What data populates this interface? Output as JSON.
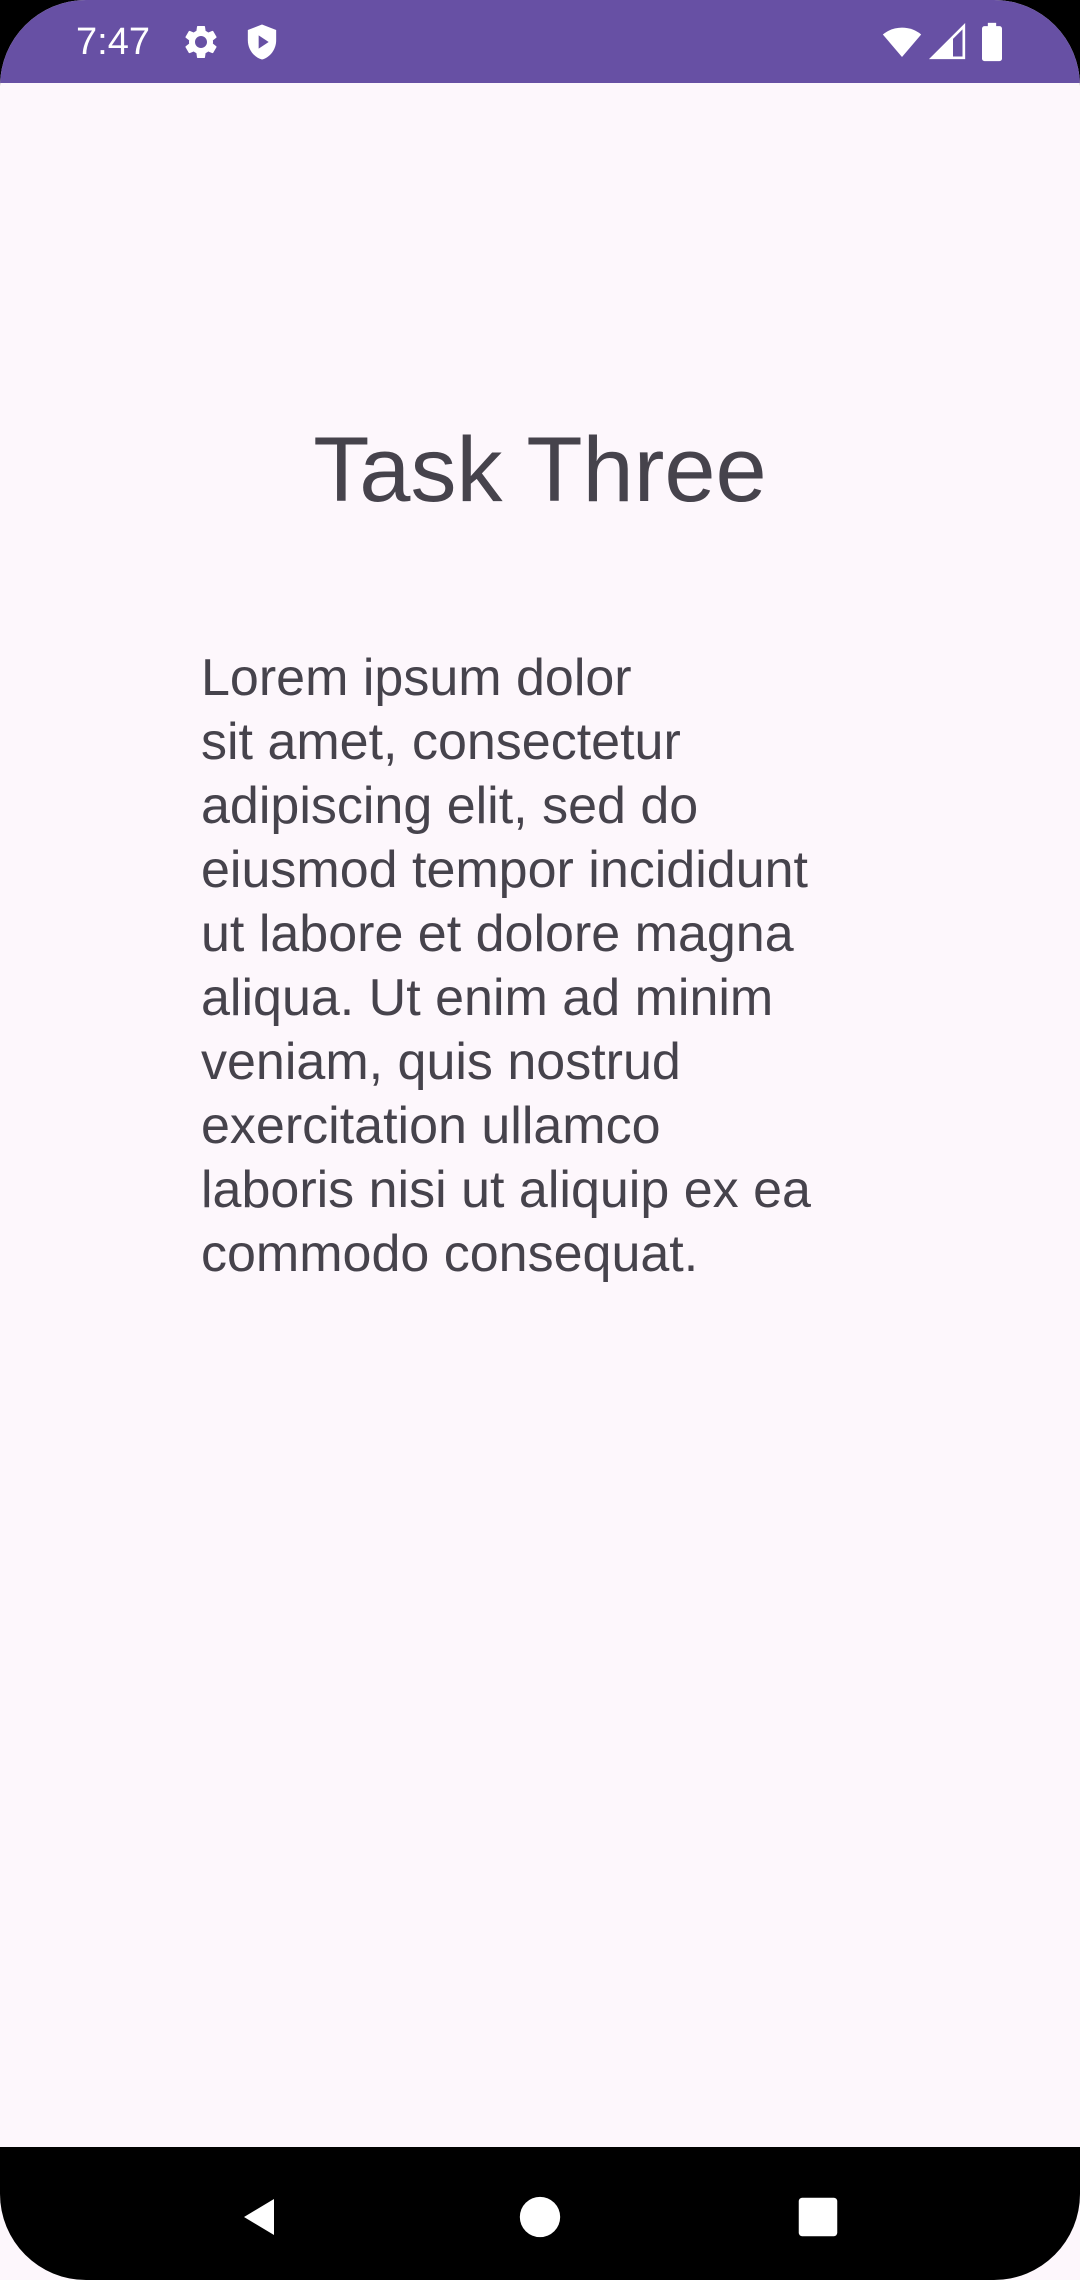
{
  "status_bar": {
    "time": "7:47",
    "icons": [
      "settings-icon",
      "shield-play-icon",
      "wifi-icon",
      "cellular-signal-icon",
      "battery-icon"
    ],
    "background_color": "#6750A4"
  },
  "main": {
    "title": "Task Three",
    "body": "Lorem ipsum dolor\nsit amet, consectetur\nadipiscing elit, sed do\neiusmod tempor incididunt\nut labore et dolore magna\naliqua. Ut enim ad minim\nveniam, quis nostrud\nexercitation ullamco\nlaboris nisi ut aliquip ex ea\ncommodo consequat.",
    "background_color": "#FDF7FC",
    "text_color": "#46434C"
  },
  "nav_bar": {
    "buttons": [
      "back-icon",
      "home-icon",
      "recents-icon"
    ]
  }
}
